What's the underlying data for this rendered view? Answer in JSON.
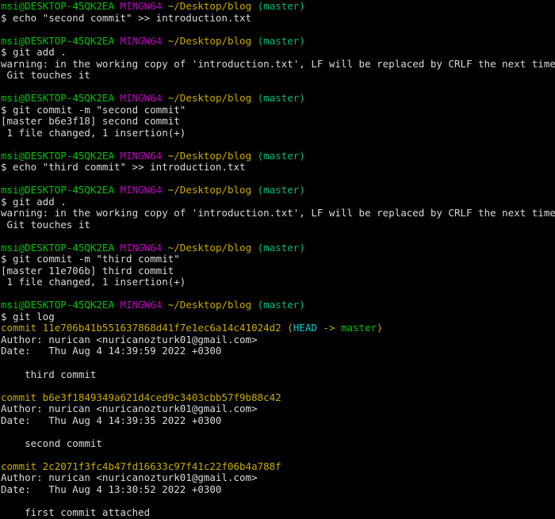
{
  "terminal": {
    "app": "git-bash-mingw64-terminal",
    "colors": {
      "background": "#000000",
      "fg": "#d9d9d9",
      "green": "#00c300",
      "magenta": "#c000c0",
      "yellow": "#c9ab00",
      "teal": "#00b97d",
      "cyan": "#00cdcd"
    },
    "prompt": {
      "user_host": "msi@DESKTOP-45QK2EA",
      "shell": "MINGW64",
      "path": "~/Desktop/blog",
      "branch": "(master)",
      "segments": [
        {
          "t": "msi@DESKTOP-45QK2EA",
          "c": "green"
        },
        {
          "t": " ",
          "c": "fg"
        },
        {
          "t": "MINGW64",
          "c": "magenta"
        },
        {
          "t": " ",
          "c": "fg"
        },
        {
          "t": "~/Desktop/blog",
          "c": "yellow"
        },
        {
          "t": " ",
          "c": "fg"
        },
        {
          "t": "(master)",
          "c": "teal"
        }
      ]
    },
    "lines": [
      {
        "kind": "prompt"
      },
      {
        "kind": "text",
        "segments": [
          {
            "t": "$ echo \"second commit\" >> introduction.txt",
            "c": "fg"
          }
        ]
      },
      {
        "kind": "blank"
      },
      {
        "kind": "prompt"
      },
      {
        "kind": "text",
        "segments": [
          {
            "t": "$ git add .",
            "c": "fg"
          }
        ]
      },
      {
        "kind": "text",
        "segments": [
          {
            "t": "warning: in the working copy of 'introduction.txt', LF will be replaced by CRLF the next time",
            "c": "fg"
          }
        ]
      },
      {
        "kind": "text",
        "segments": [
          {
            "t": " Git touches it",
            "c": "fg"
          }
        ]
      },
      {
        "kind": "blank"
      },
      {
        "kind": "prompt"
      },
      {
        "kind": "text",
        "segments": [
          {
            "t": "$ git commit -m \"second commit\"",
            "c": "fg"
          }
        ]
      },
      {
        "kind": "text",
        "segments": [
          {
            "t": "[master b6e3f18] second commit",
            "c": "fg"
          }
        ]
      },
      {
        "kind": "text",
        "segments": [
          {
            "t": " 1 file changed, 1 insertion(+)",
            "c": "fg"
          }
        ]
      },
      {
        "kind": "blank"
      },
      {
        "kind": "prompt"
      },
      {
        "kind": "text",
        "segments": [
          {
            "t": "$ echo \"third commit\" >> introduction.txt",
            "c": "fg"
          }
        ]
      },
      {
        "kind": "blank"
      },
      {
        "kind": "prompt"
      },
      {
        "kind": "text",
        "segments": [
          {
            "t": "$ git add .",
            "c": "fg"
          }
        ]
      },
      {
        "kind": "text",
        "segments": [
          {
            "t": "warning: in the working copy of 'introduction.txt', LF will be replaced by CRLF the next time",
            "c": "fg"
          }
        ]
      },
      {
        "kind": "text",
        "segments": [
          {
            "t": " Git touches it",
            "c": "fg"
          }
        ]
      },
      {
        "kind": "blank"
      },
      {
        "kind": "prompt"
      },
      {
        "kind": "text",
        "segments": [
          {
            "t": "$ git commit -m \"third commit\"",
            "c": "fg"
          }
        ]
      },
      {
        "kind": "text",
        "segments": [
          {
            "t": "[master 11e706b] third commit",
            "c": "fg"
          }
        ]
      },
      {
        "kind": "text",
        "segments": [
          {
            "t": " 1 file changed, 1 insertion(+)",
            "c": "fg"
          }
        ]
      },
      {
        "kind": "blank"
      },
      {
        "kind": "prompt"
      },
      {
        "kind": "text",
        "segments": [
          {
            "t": "$ git log",
            "c": "fg"
          }
        ]
      },
      {
        "kind": "text",
        "segments": [
          {
            "t": "commit 11e706b41b551637868d41f7e1ec6a14c41024d2",
            "c": "yellow"
          },
          {
            "t": " (",
            "c": "yellow"
          },
          {
            "t": "HEAD",
            "c": "cyan"
          },
          {
            "t": " -> ",
            "c": "yellow"
          },
          {
            "t": "master",
            "c": "green"
          },
          {
            "t": ")",
            "c": "yellow"
          }
        ]
      },
      {
        "kind": "text",
        "segments": [
          {
            "t": "Author: nurican <nuricanozturk01@gmail.com>",
            "c": "fg"
          }
        ]
      },
      {
        "kind": "text",
        "segments": [
          {
            "t": "Date:   Thu Aug 4 14:39:59 2022 +0300",
            "c": "fg"
          }
        ]
      },
      {
        "kind": "blank"
      },
      {
        "kind": "text",
        "segments": [
          {
            "t": "    third commit",
            "c": "fg"
          }
        ]
      },
      {
        "kind": "blank"
      },
      {
        "kind": "text",
        "segments": [
          {
            "t": "commit b6e3f1849349a621d4ced9c3403cbb57f9b88c42",
            "c": "yellow"
          }
        ]
      },
      {
        "kind": "text",
        "segments": [
          {
            "t": "Author: nurican <nuricanozturk01@gmail.com>",
            "c": "fg"
          }
        ]
      },
      {
        "kind": "text",
        "segments": [
          {
            "t": "Date:   Thu Aug 4 14:39:35 2022 +0300",
            "c": "fg"
          }
        ]
      },
      {
        "kind": "blank"
      },
      {
        "kind": "text",
        "segments": [
          {
            "t": "    second commit",
            "c": "fg"
          }
        ]
      },
      {
        "kind": "blank"
      },
      {
        "kind": "text",
        "segments": [
          {
            "t": "commit 2c2071f3fc4b47fd16633c97f41c22f06b4a788f",
            "c": "yellow"
          }
        ]
      },
      {
        "kind": "text",
        "segments": [
          {
            "t": "Author: nurican <nuricanozturk01@gmail.com>",
            "c": "fg"
          }
        ]
      },
      {
        "kind": "text",
        "segments": [
          {
            "t": "Date:   Thu Aug 4 13:30:52 2022 +0300",
            "c": "fg"
          }
        ]
      },
      {
        "kind": "blank"
      },
      {
        "kind": "text",
        "segments": [
          {
            "t": "    first commit attached",
            "c": "fg"
          }
        ]
      }
    ]
  }
}
